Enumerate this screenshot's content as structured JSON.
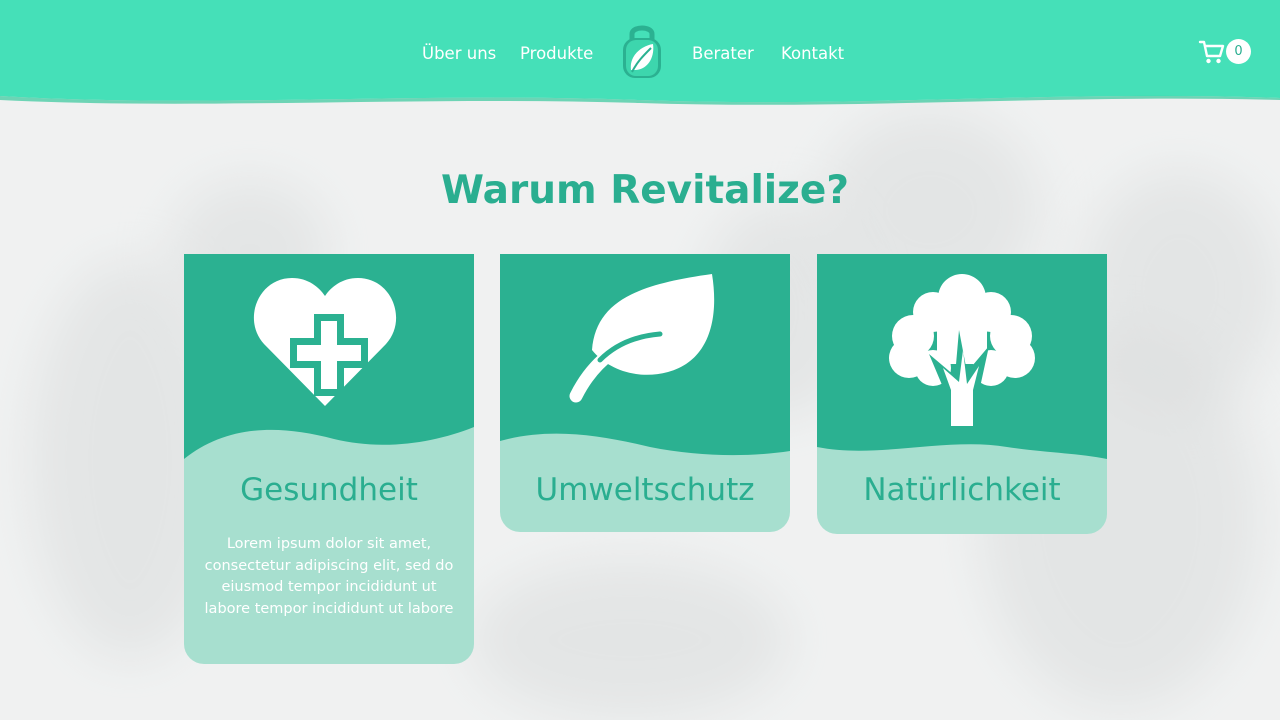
{
  "nav": {
    "left_links": [
      "Über uns",
      "Produkte"
    ],
    "right_links": [
      "Berater",
      "Kontakt"
    ],
    "logo_icon": "leaf-lock-logo",
    "cart_icon": "shopping-cart-icon",
    "cart_count": "0"
  },
  "section": {
    "title": "Warum Revitalize?"
  },
  "cards": [
    {
      "icon": "heart-medical-cross-icon",
      "title": "Gesundheit",
      "text": "Lorem ipsum dolor sit amet, consectetur adipiscing elit, sed do eiusmod tempor incididunt ut labore tempor incididunt ut labore"
    },
    {
      "icon": "leaf-icon",
      "title": "Umweltschutz",
      "text": ""
    },
    {
      "icon": "tree-icon",
      "title": "Natürlichkeit",
      "text": ""
    }
  ],
  "next_section": {
    "title": ""
  },
  "colors": {
    "header": "#45e0b8",
    "card_top": "#2bb191",
    "card_bottom": "#a7dfcf",
    "accent_text": "#2aae90"
  }
}
